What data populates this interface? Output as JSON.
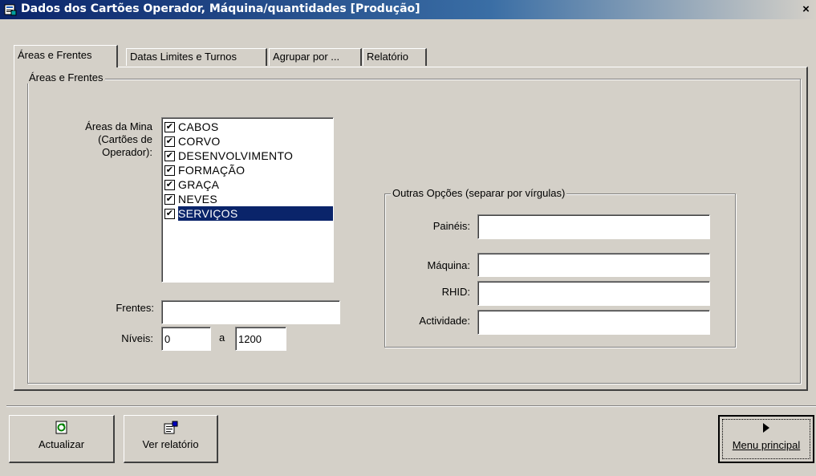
{
  "window": {
    "title": "Dados dos Cartões Operador, Máquina/quantidades [Produção]",
    "app_icon": "report-window-icon",
    "close_label": "×"
  },
  "tabs": [
    {
      "label": "Áreas e Frentes",
      "active": true
    },
    {
      "label": "Datas Limites e Turnos",
      "active": false
    },
    {
      "label": "Agrupar por ...",
      "active": false
    },
    {
      "label": "Relatório",
      "active": false
    }
  ],
  "areas_group": {
    "label": "Áreas e Frentes",
    "areas_label_1": "Áreas da Mina",
    "areas_label_2": "(Cartões de",
    "areas_label_3": "Operador):",
    "areas": [
      {
        "label": "CABOS",
        "checked": true,
        "selected": false
      },
      {
        "label": "CORVO",
        "checked": true,
        "selected": false
      },
      {
        "label": "DESENVOLVIMENTO",
        "checked": true,
        "selected": false
      },
      {
        "label": "FORMAÇÃO",
        "checked": true,
        "selected": false
      },
      {
        "label": "GRAÇA",
        "checked": true,
        "selected": false
      },
      {
        "label": "NEVES",
        "checked": true,
        "selected": false
      },
      {
        "label": "SERVIÇOS",
        "checked": true,
        "selected": true
      }
    ],
    "frentes_label": "Frentes:",
    "frentes_value": "",
    "niveis_label": "Níveis:",
    "niveis_from": "0",
    "niveis_sep": "a",
    "niveis_to": "1200"
  },
  "other_options": {
    "label": "Outras Opções (separar por vírgulas)",
    "paineis_label": "Painéis:",
    "paineis_value": "",
    "maquina_label": "Máquina:",
    "maquina_value": "",
    "rhid_label": "RHID:",
    "rhid_value": "",
    "actividade_label": "Actividade:",
    "actividade_value": ""
  },
  "buttons": {
    "actualizar": {
      "label": "Actualizar",
      "icon": "refresh-icon"
    },
    "ver_relatorio": {
      "label": "Ver relatório",
      "icon": "report-icon"
    },
    "menu_principal": {
      "label": "Menu principal",
      "icon": "play-arrow-icon"
    }
  },
  "colors": {
    "titlebar": "#0a246a",
    "face": "#d4d0c8",
    "selection": "#0a246a"
  }
}
